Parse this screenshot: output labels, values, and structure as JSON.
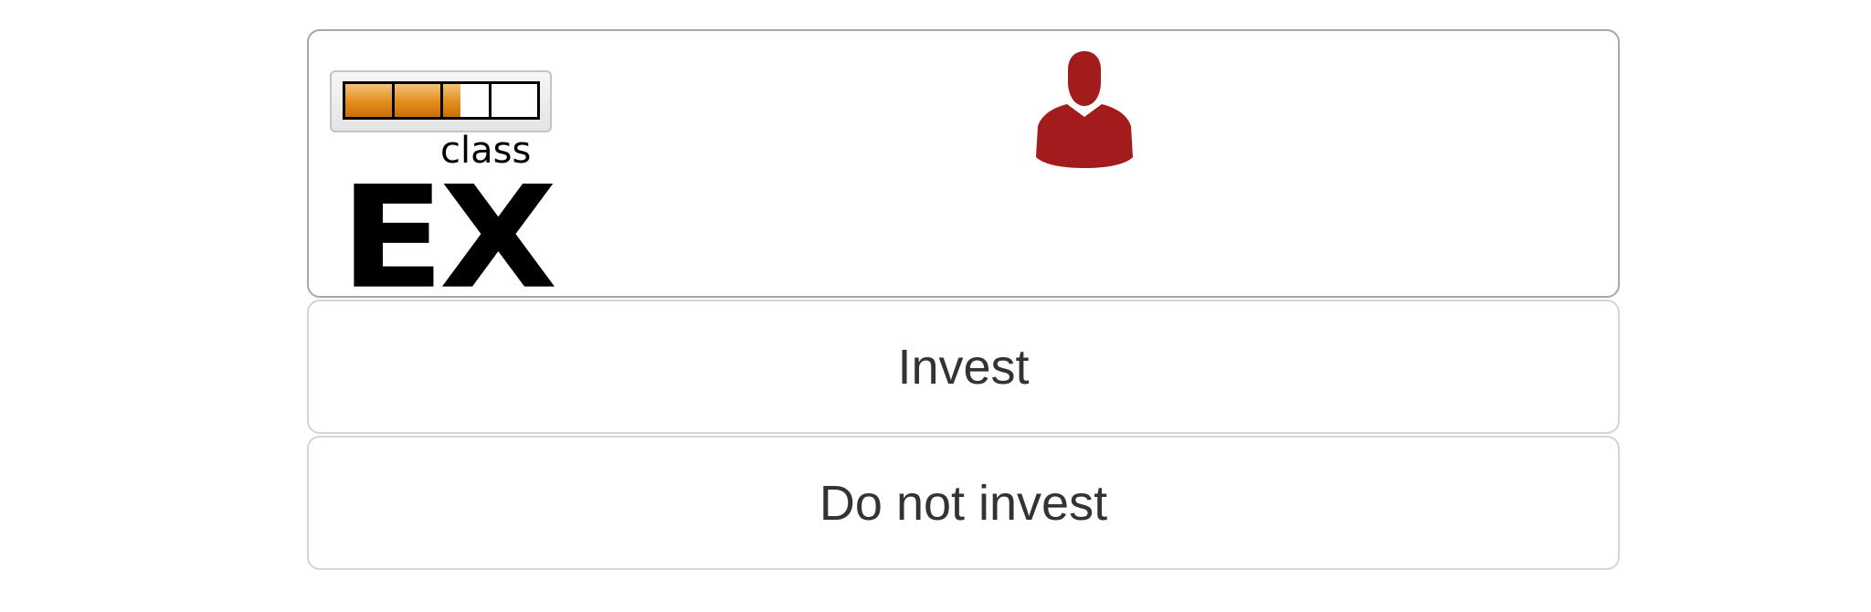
{
  "header": {
    "logo": {
      "letters": "EX",
      "superscript": "class",
      "meter_fill": 0.6,
      "meter_colors": [
        "#f3c27a",
        "#e38d1c",
        "#c86f08"
      ]
    },
    "avatar_icon": "person-icon",
    "avatar_color": "#a21c1c"
  },
  "choices": {
    "invest_label": "Invest",
    "do_not_invest_label": "Do not invest"
  }
}
